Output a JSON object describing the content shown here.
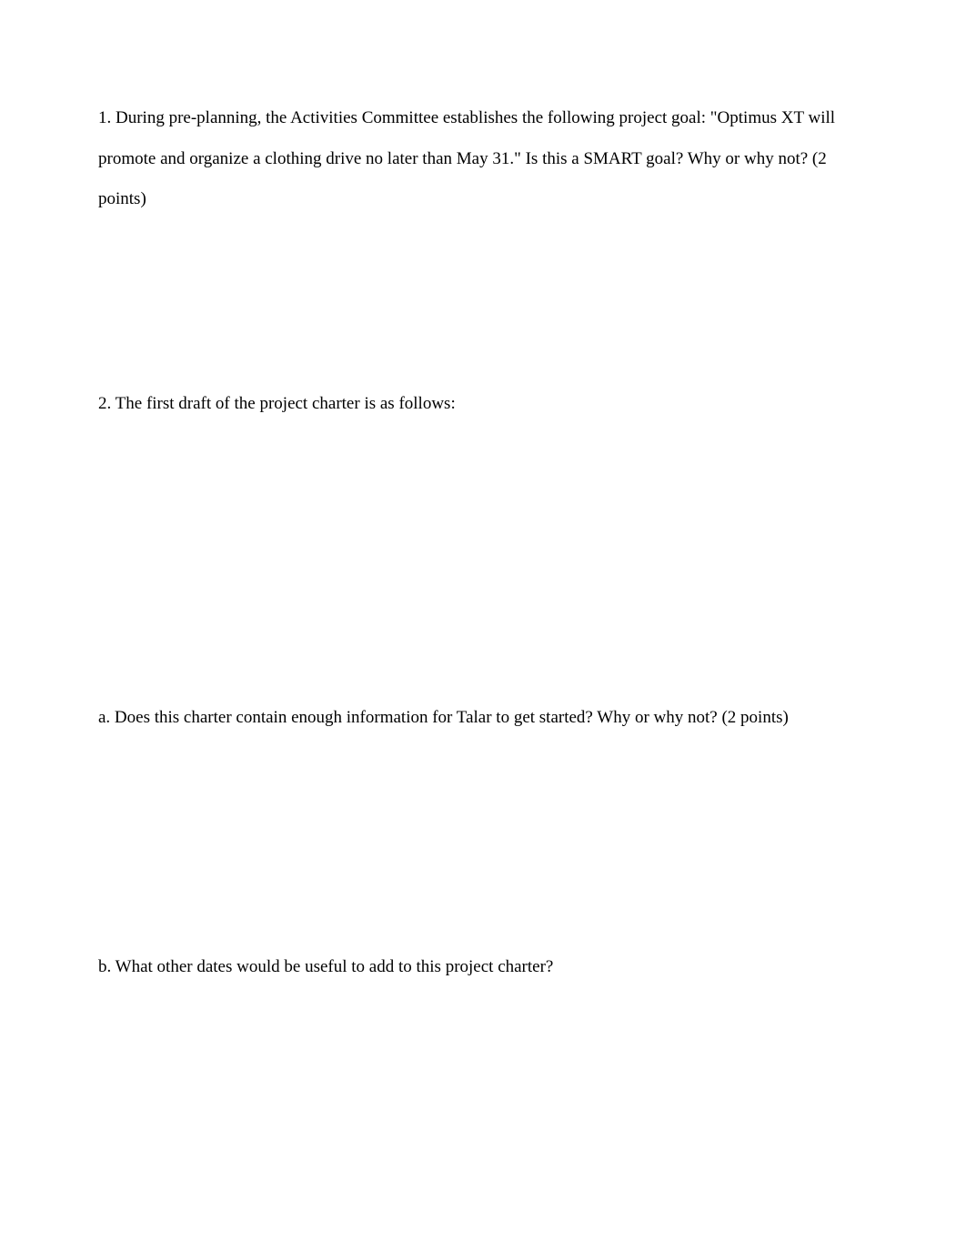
{
  "document": {
    "q1": {
      "text": "1. During pre-planning, the Activities Committee establishes the following project goal: \"Optimus XT will promote and organize a clothing drive no later than May 31.\" Is this a SMART goal? Why or why not? (2 points)"
    },
    "q2": {
      "text": "2. The first draft of the project charter is as follows:"
    },
    "q2a": {
      "text": "a. Does this charter contain enough information for Talar to get started? Why or why not? (2 points)"
    },
    "q2b": {
      "text": "b. What other dates would be useful to add to this project charter?"
    }
  }
}
